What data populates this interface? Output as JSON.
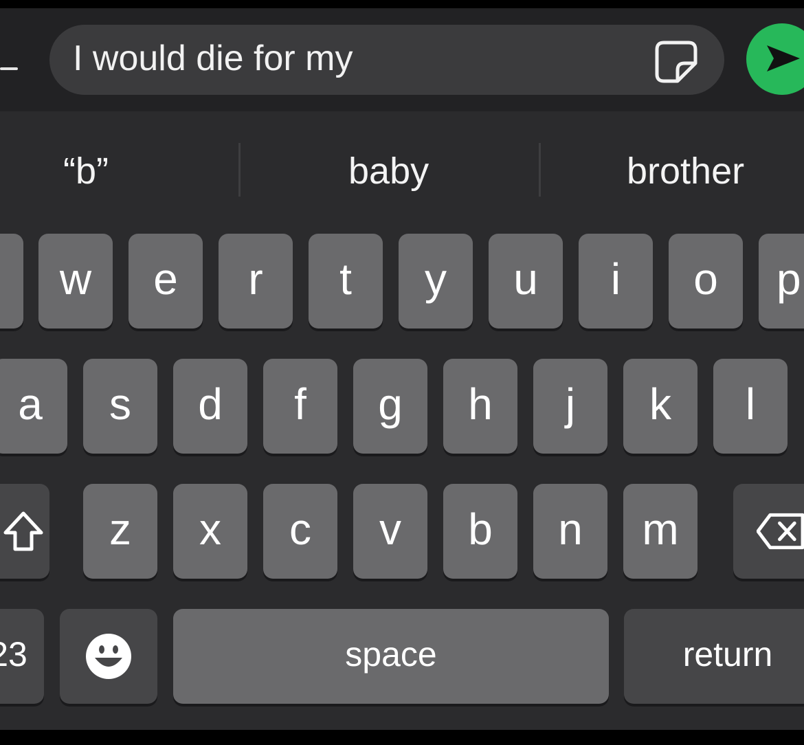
{
  "message": {
    "text": "I would die for my"
  },
  "suggestions": [
    "“b”",
    "baby",
    "brother"
  ],
  "keyboard": {
    "row1": [
      "w",
      "e",
      "r",
      "t",
      "y",
      "u",
      "i",
      "o",
      "p"
    ],
    "row2": [
      "a",
      "s",
      "d",
      "f",
      "g",
      "h",
      "j",
      "k",
      "l"
    ],
    "row3": [
      "z",
      "x",
      "c",
      "v",
      "b",
      "n",
      "m"
    ],
    "numbers_label": "23",
    "space_label": "space",
    "return_label": "return"
  },
  "colors": {
    "send_button": "#27b85a",
    "key": "#6a6a6c",
    "function_key": "#464648",
    "background": "#2b2b2d"
  },
  "icons": [
    "dash-icon",
    "sticker-icon",
    "send-icon",
    "shift-icon",
    "backspace-icon",
    "emoji-icon"
  ]
}
